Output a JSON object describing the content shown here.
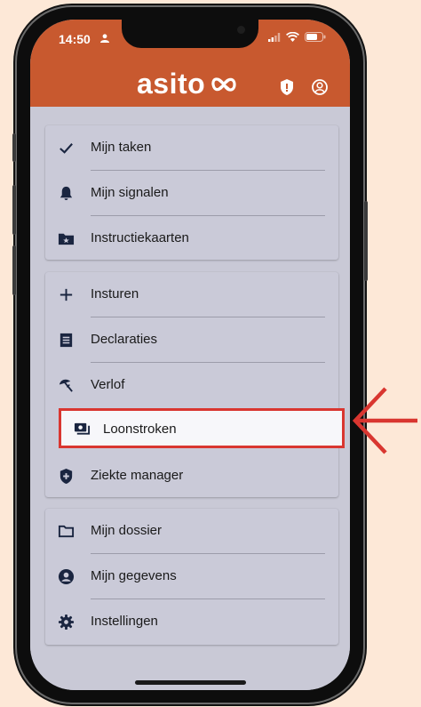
{
  "status_bar": {
    "time": "14:50"
  },
  "header": {
    "logo_text": "asito"
  },
  "menu": {
    "group1": [
      {
        "label": "Mijn taken",
        "icon": "check-icon"
      },
      {
        "label": "Mijn signalen",
        "icon": "bell-icon"
      },
      {
        "label": "Instructiekaarten",
        "icon": "folder-star-icon"
      }
    ],
    "group2": [
      {
        "label": "Insturen",
        "icon": "plus-icon"
      },
      {
        "label": "Declaraties",
        "icon": "receipt-icon"
      },
      {
        "label": "Verlof",
        "icon": "beach-umbrella-icon"
      },
      {
        "label": "Loonstroken",
        "icon": "payslip-icon"
      },
      {
        "label": "Ziekte manager",
        "icon": "shield-plus-icon"
      }
    ],
    "group3": [
      {
        "label": "Mijn dossier",
        "icon": "folder-icon"
      },
      {
        "label": "Mijn gegevens",
        "icon": "account-circle-icon"
      },
      {
        "label": "Instellingen",
        "icon": "gear-icon"
      }
    ]
  },
  "colors": {
    "brand": "#c8592f",
    "highlight_border": "#d93630",
    "background": "#fde8d7"
  }
}
